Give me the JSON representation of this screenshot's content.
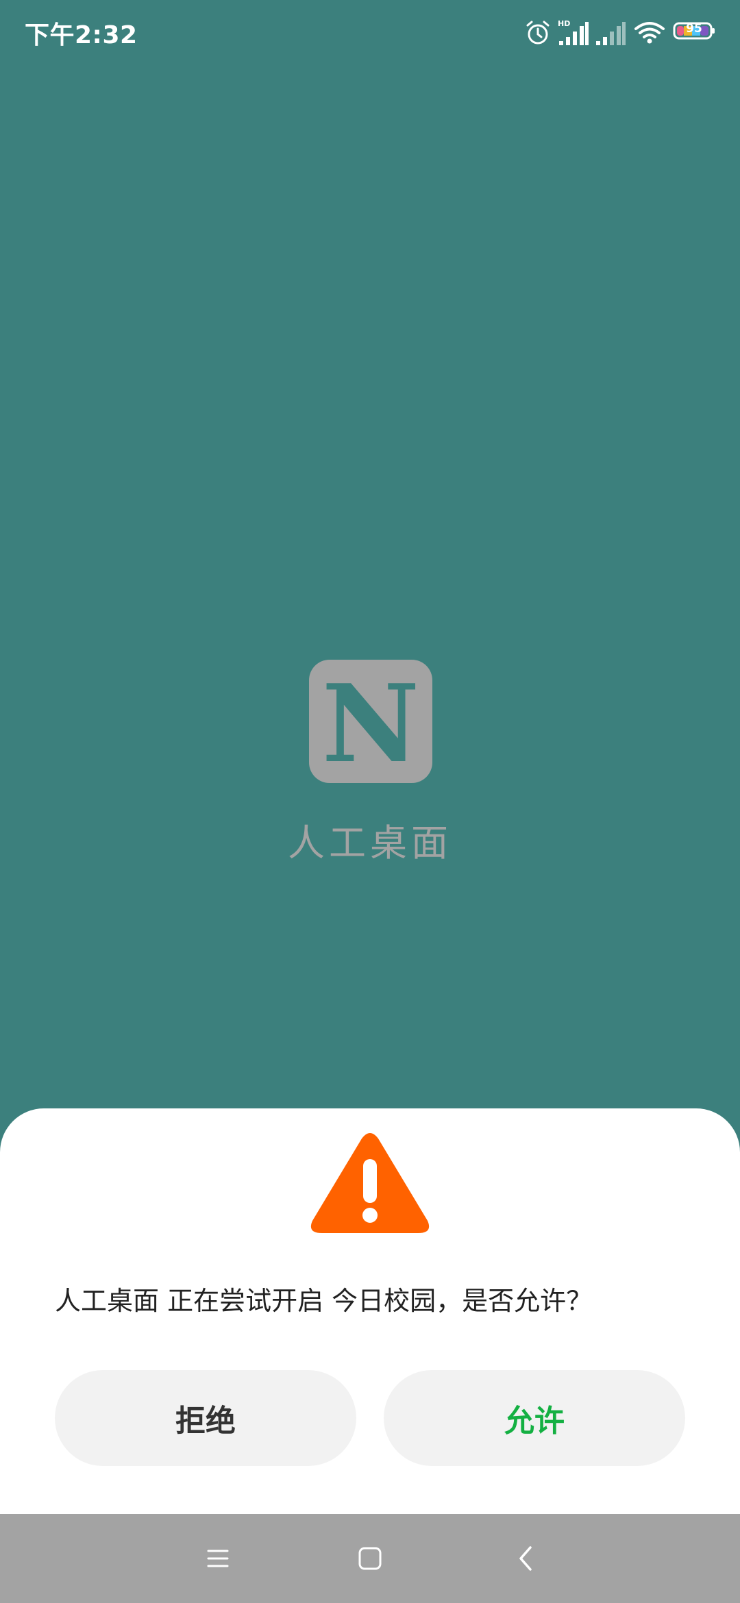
{
  "status_bar": {
    "time": "下午2:32",
    "signal_label": "HD",
    "battery_level": "95",
    "icons": [
      "alarm-icon",
      "signal-hd-icon",
      "signal-icon",
      "wifi-icon",
      "battery-icon"
    ]
  },
  "splash": {
    "logo_letter": "N",
    "app_name": "人工桌面",
    "background_color": "#3c807d",
    "logo_color": "#a3a3a3"
  },
  "dialog": {
    "icon": "warning-icon",
    "icon_color": "#ff6200",
    "message": "人工桌面 正在尝试开启 今日校园，是否允许？",
    "deny_label": "拒绝",
    "allow_label": "允许",
    "allow_color": "#14b042"
  },
  "nav_bar": {
    "icons": [
      "menu-icon",
      "home-icon",
      "back-icon"
    ]
  }
}
